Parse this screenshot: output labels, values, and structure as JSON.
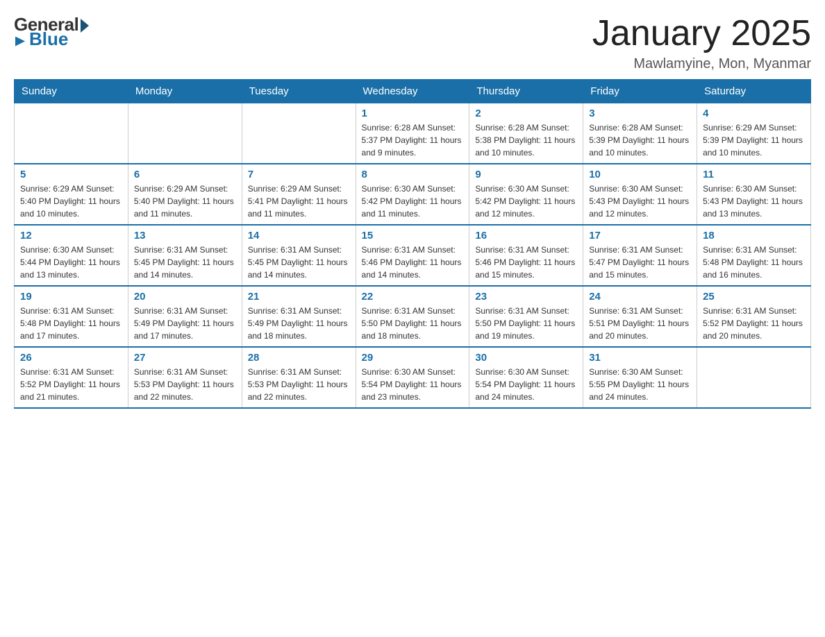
{
  "logo": {
    "general": "General",
    "blue": "Blue"
  },
  "title": "January 2025",
  "location": "Mawlamyine, Mon, Myanmar",
  "days_of_week": [
    "Sunday",
    "Monday",
    "Tuesday",
    "Wednesday",
    "Thursday",
    "Friday",
    "Saturday"
  ],
  "weeks": [
    [
      {
        "day": "",
        "info": ""
      },
      {
        "day": "",
        "info": ""
      },
      {
        "day": "",
        "info": ""
      },
      {
        "day": "1",
        "info": "Sunrise: 6:28 AM\nSunset: 5:37 PM\nDaylight: 11 hours and 9 minutes."
      },
      {
        "day": "2",
        "info": "Sunrise: 6:28 AM\nSunset: 5:38 PM\nDaylight: 11 hours and 10 minutes."
      },
      {
        "day": "3",
        "info": "Sunrise: 6:28 AM\nSunset: 5:39 PM\nDaylight: 11 hours and 10 minutes."
      },
      {
        "day": "4",
        "info": "Sunrise: 6:29 AM\nSunset: 5:39 PM\nDaylight: 11 hours and 10 minutes."
      }
    ],
    [
      {
        "day": "5",
        "info": "Sunrise: 6:29 AM\nSunset: 5:40 PM\nDaylight: 11 hours and 10 minutes."
      },
      {
        "day": "6",
        "info": "Sunrise: 6:29 AM\nSunset: 5:40 PM\nDaylight: 11 hours and 11 minutes."
      },
      {
        "day": "7",
        "info": "Sunrise: 6:29 AM\nSunset: 5:41 PM\nDaylight: 11 hours and 11 minutes."
      },
      {
        "day": "8",
        "info": "Sunrise: 6:30 AM\nSunset: 5:42 PM\nDaylight: 11 hours and 11 minutes."
      },
      {
        "day": "9",
        "info": "Sunrise: 6:30 AM\nSunset: 5:42 PM\nDaylight: 11 hours and 12 minutes."
      },
      {
        "day": "10",
        "info": "Sunrise: 6:30 AM\nSunset: 5:43 PM\nDaylight: 11 hours and 12 minutes."
      },
      {
        "day": "11",
        "info": "Sunrise: 6:30 AM\nSunset: 5:43 PM\nDaylight: 11 hours and 13 minutes."
      }
    ],
    [
      {
        "day": "12",
        "info": "Sunrise: 6:30 AM\nSunset: 5:44 PM\nDaylight: 11 hours and 13 minutes."
      },
      {
        "day": "13",
        "info": "Sunrise: 6:31 AM\nSunset: 5:45 PM\nDaylight: 11 hours and 14 minutes."
      },
      {
        "day": "14",
        "info": "Sunrise: 6:31 AM\nSunset: 5:45 PM\nDaylight: 11 hours and 14 minutes."
      },
      {
        "day": "15",
        "info": "Sunrise: 6:31 AM\nSunset: 5:46 PM\nDaylight: 11 hours and 14 minutes."
      },
      {
        "day": "16",
        "info": "Sunrise: 6:31 AM\nSunset: 5:46 PM\nDaylight: 11 hours and 15 minutes."
      },
      {
        "day": "17",
        "info": "Sunrise: 6:31 AM\nSunset: 5:47 PM\nDaylight: 11 hours and 15 minutes."
      },
      {
        "day": "18",
        "info": "Sunrise: 6:31 AM\nSunset: 5:48 PM\nDaylight: 11 hours and 16 minutes."
      }
    ],
    [
      {
        "day": "19",
        "info": "Sunrise: 6:31 AM\nSunset: 5:48 PM\nDaylight: 11 hours and 17 minutes."
      },
      {
        "day": "20",
        "info": "Sunrise: 6:31 AM\nSunset: 5:49 PM\nDaylight: 11 hours and 17 minutes."
      },
      {
        "day": "21",
        "info": "Sunrise: 6:31 AM\nSunset: 5:49 PM\nDaylight: 11 hours and 18 minutes."
      },
      {
        "day": "22",
        "info": "Sunrise: 6:31 AM\nSunset: 5:50 PM\nDaylight: 11 hours and 18 minutes."
      },
      {
        "day": "23",
        "info": "Sunrise: 6:31 AM\nSunset: 5:50 PM\nDaylight: 11 hours and 19 minutes."
      },
      {
        "day": "24",
        "info": "Sunrise: 6:31 AM\nSunset: 5:51 PM\nDaylight: 11 hours and 20 minutes."
      },
      {
        "day": "25",
        "info": "Sunrise: 6:31 AM\nSunset: 5:52 PM\nDaylight: 11 hours and 20 minutes."
      }
    ],
    [
      {
        "day": "26",
        "info": "Sunrise: 6:31 AM\nSunset: 5:52 PM\nDaylight: 11 hours and 21 minutes."
      },
      {
        "day": "27",
        "info": "Sunrise: 6:31 AM\nSunset: 5:53 PM\nDaylight: 11 hours and 22 minutes."
      },
      {
        "day": "28",
        "info": "Sunrise: 6:31 AM\nSunset: 5:53 PM\nDaylight: 11 hours and 22 minutes."
      },
      {
        "day": "29",
        "info": "Sunrise: 6:30 AM\nSunset: 5:54 PM\nDaylight: 11 hours and 23 minutes."
      },
      {
        "day": "30",
        "info": "Sunrise: 6:30 AM\nSunset: 5:54 PM\nDaylight: 11 hours and 24 minutes."
      },
      {
        "day": "31",
        "info": "Sunrise: 6:30 AM\nSunset: 5:55 PM\nDaylight: 11 hours and 24 minutes."
      },
      {
        "day": "",
        "info": ""
      }
    ]
  ],
  "colors": {
    "header_bg": "#1a6fa8",
    "accent": "#1a6fa8",
    "text": "#333"
  }
}
